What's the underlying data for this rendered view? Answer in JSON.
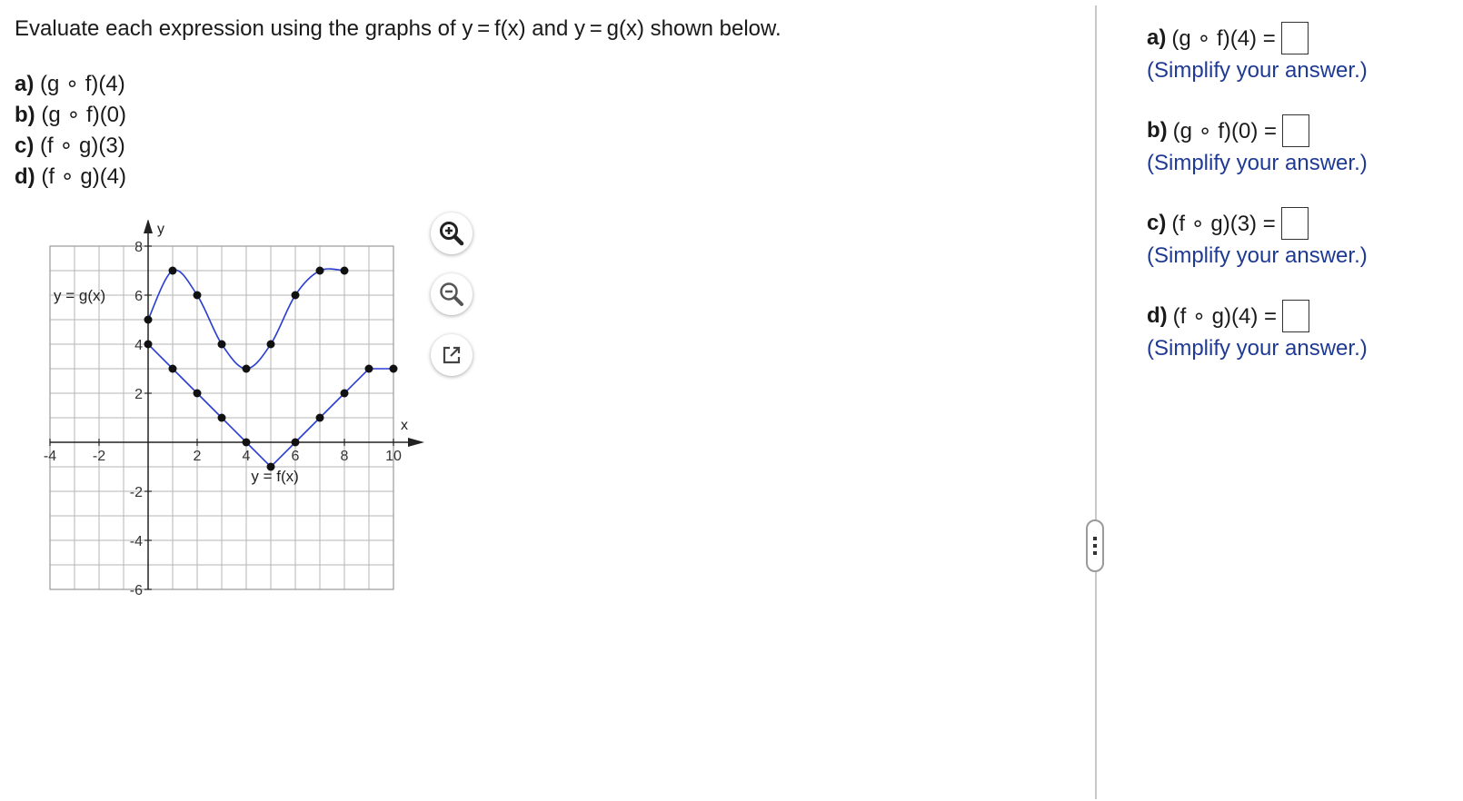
{
  "question": {
    "instruction": "Evaluate each expression using the graphs of y = f(x) and y = g(x) shown below.",
    "parts": [
      {
        "letter": "a)",
        "expr": "(g ∘ f)(4)"
      },
      {
        "letter": "b)",
        "expr": "(g ∘ f)(0)"
      },
      {
        "letter": "c)",
        "expr": "(f ∘ g)(3)"
      },
      {
        "letter": "d)",
        "expr": "(f ∘ g)(4)"
      }
    ]
  },
  "graph": {
    "x_axis_label": "x",
    "y_axis_label": "y",
    "x_ticks": [
      -4,
      -2,
      2,
      4,
      6,
      8,
      10
    ],
    "y_ticks": [
      8,
      6,
      4,
      2,
      -2,
      -4,
      -6
    ],
    "xlim": [
      -4,
      10
    ],
    "ylim": [
      -6,
      8
    ],
    "g_label": "y = g(x)",
    "f_label": "y = f(x)",
    "curve_color": "#2a3fd1",
    "g_points": [
      [
        0,
        5
      ],
      [
        1,
        7
      ],
      [
        2,
        6
      ],
      [
        3,
        4
      ],
      [
        4,
        3
      ],
      [
        5,
        4
      ],
      [
        6,
        6
      ],
      [
        7,
        7
      ],
      [
        8,
        7
      ]
    ],
    "f_points": [
      [
        0,
        4
      ],
      [
        1,
        3
      ],
      [
        2,
        2
      ],
      [
        3,
        1
      ],
      [
        4,
        0
      ],
      [
        5,
        -1
      ],
      [
        6,
        0
      ],
      [
        7,
        1
      ],
      [
        8,
        2
      ],
      [
        9,
        3
      ],
      [
        10,
        3
      ]
    ]
  },
  "tools": {
    "zoom_in": "zoom-in-icon",
    "zoom_out": "zoom-out-icon",
    "popout": "external-window-icon"
  },
  "answers": [
    {
      "letter": "a)",
      "expr": "(g ∘ f)(4) =",
      "hint": "(Simplify your answer.)"
    },
    {
      "letter": "b)",
      "expr": "(g ∘ f)(0) =",
      "hint": "(Simplify your answer.)"
    },
    {
      "letter": "c)",
      "expr": "(f ∘ g)(3) =",
      "hint": "(Simplify your answer.)"
    },
    {
      "letter": "d)",
      "expr": "(f ∘ g)(4) =",
      "hint": "(Simplify your answer.)"
    }
  ]
}
